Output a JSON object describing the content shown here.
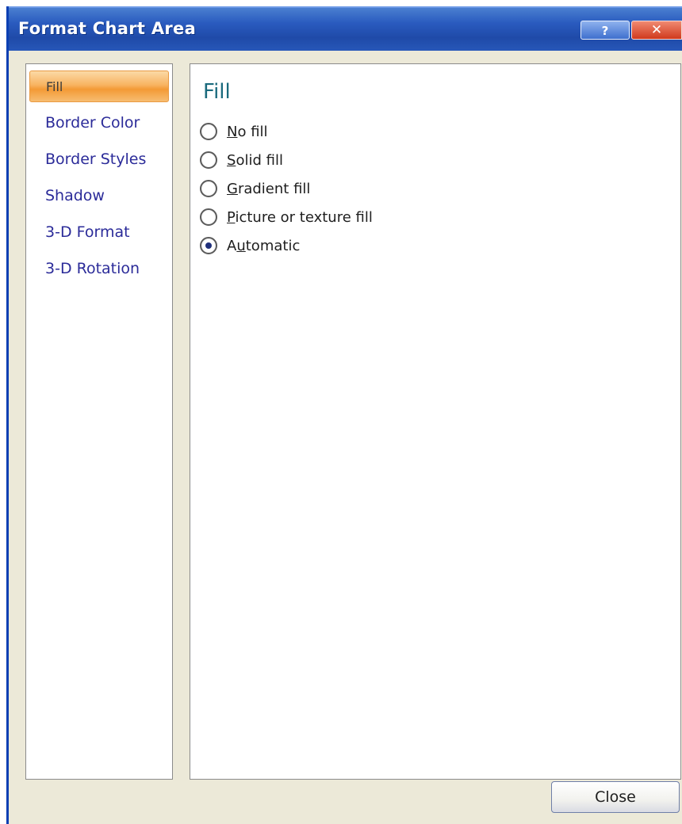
{
  "window": {
    "title": "Format Chart Area",
    "help_glyph": "?",
    "close_glyph": "✕"
  },
  "sidebar": {
    "items": [
      {
        "label": "Fill",
        "active": true
      },
      {
        "label": "Border Color",
        "active": false
      },
      {
        "label": "Border Styles",
        "active": false
      },
      {
        "label": "Shadow",
        "active": false
      },
      {
        "label": "3-D Format",
        "active": false
      },
      {
        "label": "3-D Rotation",
        "active": false
      }
    ]
  },
  "panel": {
    "title": "Fill",
    "options": [
      {
        "label": "No fill",
        "accel": "N",
        "checked": false
      },
      {
        "label": "Solid fill",
        "accel": "S",
        "checked": false
      },
      {
        "label": "Gradient fill",
        "accel": "G",
        "checked": false
      },
      {
        "label": "Picture or texture fill",
        "accel": "P",
        "checked": false
      },
      {
        "label": "Automatic",
        "accel": "u",
        "checked": true
      }
    ]
  },
  "footer": {
    "close_label": "Close"
  },
  "colors": {
    "titlebar": "#2a5bbf",
    "active_item": "#f39a35",
    "link_text": "#2b2b99",
    "section_title": "#1a6a7d",
    "dialog_bg": "#ece9d8"
  }
}
